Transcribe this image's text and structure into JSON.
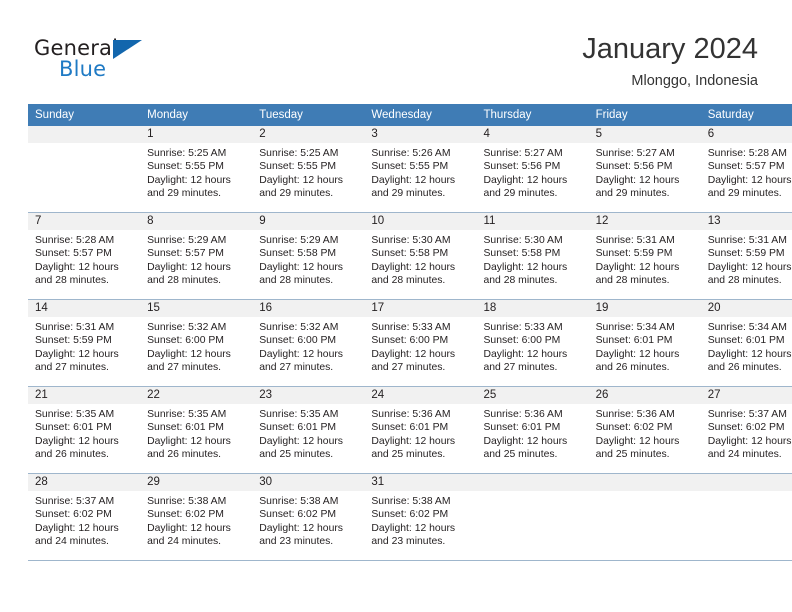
{
  "brand": {
    "name_part1": "General",
    "name_part2": "Blue",
    "triangle_icon": "triangle-icon",
    "color_primary": "#1266ad",
    "color_secondary": "#1f7ac4"
  },
  "header": {
    "title": "January 2024",
    "subtitle": "Mlonggo, Indonesia",
    "header_bg": "#3f7cb5",
    "band_bg": "#f1f1f1",
    "grid_line": "#9fb6cc"
  },
  "weekday_headers": [
    "Sunday",
    "Monday",
    "Tuesday",
    "Wednesday",
    "Thursday",
    "Friday",
    "Saturday"
  ],
  "weeks": [
    [
      {
        "day": "",
        "blank": true,
        "sunrise": "",
        "sunset": "",
        "daylight_1": "",
        "daylight_2": ""
      },
      {
        "day": "1",
        "sunrise": "Sunrise: 5:25 AM",
        "sunset": "Sunset: 5:55 PM",
        "daylight_1": "Daylight: 12 hours",
        "daylight_2": "and 29 minutes."
      },
      {
        "day": "2",
        "sunrise": "Sunrise: 5:25 AM",
        "sunset": "Sunset: 5:55 PM",
        "daylight_1": "Daylight: 12 hours",
        "daylight_2": "and 29 minutes."
      },
      {
        "day": "3",
        "sunrise": "Sunrise: 5:26 AM",
        "sunset": "Sunset: 5:55 PM",
        "daylight_1": "Daylight: 12 hours",
        "daylight_2": "and 29 minutes."
      },
      {
        "day": "4",
        "sunrise": "Sunrise: 5:27 AM",
        "sunset": "Sunset: 5:56 PM",
        "daylight_1": "Daylight: 12 hours",
        "daylight_2": "and 29 minutes."
      },
      {
        "day": "5",
        "sunrise": "Sunrise: 5:27 AM",
        "sunset": "Sunset: 5:56 PM",
        "daylight_1": "Daylight: 12 hours",
        "daylight_2": "and 29 minutes."
      },
      {
        "day": "6",
        "sunrise": "Sunrise: 5:28 AM",
        "sunset": "Sunset: 5:57 PM",
        "daylight_1": "Daylight: 12 hours",
        "daylight_2": "and 29 minutes."
      }
    ],
    [
      {
        "day": "7",
        "sunrise": "Sunrise: 5:28 AM",
        "sunset": "Sunset: 5:57 PM",
        "daylight_1": "Daylight: 12 hours",
        "daylight_2": "and 28 minutes."
      },
      {
        "day": "8",
        "sunrise": "Sunrise: 5:29 AM",
        "sunset": "Sunset: 5:57 PM",
        "daylight_1": "Daylight: 12 hours",
        "daylight_2": "and 28 minutes."
      },
      {
        "day": "9",
        "sunrise": "Sunrise: 5:29 AM",
        "sunset": "Sunset: 5:58 PM",
        "daylight_1": "Daylight: 12 hours",
        "daylight_2": "and 28 minutes."
      },
      {
        "day": "10",
        "sunrise": "Sunrise: 5:30 AM",
        "sunset": "Sunset: 5:58 PM",
        "daylight_1": "Daylight: 12 hours",
        "daylight_2": "and 28 minutes."
      },
      {
        "day": "11",
        "sunrise": "Sunrise: 5:30 AM",
        "sunset": "Sunset: 5:58 PM",
        "daylight_1": "Daylight: 12 hours",
        "daylight_2": "and 28 minutes."
      },
      {
        "day": "12",
        "sunrise": "Sunrise: 5:31 AM",
        "sunset": "Sunset: 5:59 PM",
        "daylight_1": "Daylight: 12 hours",
        "daylight_2": "and 28 minutes."
      },
      {
        "day": "13",
        "sunrise": "Sunrise: 5:31 AM",
        "sunset": "Sunset: 5:59 PM",
        "daylight_1": "Daylight: 12 hours",
        "daylight_2": "and 28 minutes."
      }
    ],
    [
      {
        "day": "14",
        "sunrise": "Sunrise: 5:31 AM",
        "sunset": "Sunset: 5:59 PM",
        "daylight_1": "Daylight: 12 hours",
        "daylight_2": "and 27 minutes."
      },
      {
        "day": "15",
        "sunrise": "Sunrise: 5:32 AM",
        "sunset": "Sunset: 6:00 PM",
        "daylight_1": "Daylight: 12 hours",
        "daylight_2": "and 27 minutes."
      },
      {
        "day": "16",
        "sunrise": "Sunrise: 5:32 AM",
        "sunset": "Sunset: 6:00 PM",
        "daylight_1": "Daylight: 12 hours",
        "daylight_2": "and 27 minutes."
      },
      {
        "day": "17",
        "sunrise": "Sunrise: 5:33 AM",
        "sunset": "Sunset: 6:00 PM",
        "daylight_1": "Daylight: 12 hours",
        "daylight_2": "and 27 minutes."
      },
      {
        "day": "18",
        "sunrise": "Sunrise: 5:33 AM",
        "sunset": "Sunset: 6:00 PM",
        "daylight_1": "Daylight: 12 hours",
        "daylight_2": "and 27 minutes."
      },
      {
        "day": "19",
        "sunrise": "Sunrise: 5:34 AM",
        "sunset": "Sunset: 6:01 PM",
        "daylight_1": "Daylight: 12 hours",
        "daylight_2": "and 26 minutes."
      },
      {
        "day": "20",
        "sunrise": "Sunrise: 5:34 AM",
        "sunset": "Sunset: 6:01 PM",
        "daylight_1": "Daylight: 12 hours",
        "daylight_2": "and 26 minutes."
      }
    ],
    [
      {
        "day": "21",
        "sunrise": "Sunrise: 5:35 AM",
        "sunset": "Sunset: 6:01 PM",
        "daylight_1": "Daylight: 12 hours",
        "daylight_2": "and 26 minutes."
      },
      {
        "day": "22",
        "sunrise": "Sunrise: 5:35 AM",
        "sunset": "Sunset: 6:01 PM",
        "daylight_1": "Daylight: 12 hours",
        "daylight_2": "and 26 minutes."
      },
      {
        "day": "23",
        "sunrise": "Sunrise: 5:35 AM",
        "sunset": "Sunset: 6:01 PM",
        "daylight_1": "Daylight: 12 hours",
        "daylight_2": "and 25 minutes."
      },
      {
        "day": "24",
        "sunrise": "Sunrise: 5:36 AM",
        "sunset": "Sunset: 6:01 PM",
        "daylight_1": "Daylight: 12 hours",
        "daylight_2": "and 25 minutes."
      },
      {
        "day": "25",
        "sunrise": "Sunrise: 5:36 AM",
        "sunset": "Sunset: 6:01 PM",
        "daylight_1": "Daylight: 12 hours",
        "daylight_2": "and 25 minutes."
      },
      {
        "day": "26",
        "sunrise": "Sunrise: 5:36 AM",
        "sunset": "Sunset: 6:02 PM",
        "daylight_1": "Daylight: 12 hours",
        "daylight_2": "and 25 minutes."
      },
      {
        "day": "27",
        "sunrise": "Sunrise: 5:37 AM",
        "sunset": "Sunset: 6:02 PM",
        "daylight_1": "Daylight: 12 hours",
        "daylight_2": "and 24 minutes."
      }
    ],
    [
      {
        "day": "28",
        "sunrise": "Sunrise: 5:37 AM",
        "sunset": "Sunset: 6:02 PM",
        "daylight_1": "Daylight: 12 hours",
        "daylight_2": "and 24 minutes."
      },
      {
        "day": "29",
        "sunrise": "Sunrise: 5:38 AM",
        "sunset": "Sunset: 6:02 PM",
        "daylight_1": "Daylight: 12 hours",
        "daylight_2": "and 24 minutes."
      },
      {
        "day": "30",
        "sunrise": "Sunrise: 5:38 AM",
        "sunset": "Sunset: 6:02 PM",
        "daylight_1": "Daylight: 12 hours",
        "daylight_2": "and 23 minutes."
      },
      {
        "day": "31",
        "sunrise": "Sunrise: 5:38 AM",
        "sunset": "Sunset: 6:02 PM",
        "daylight_1": "Daylight: 12 hours",
        "daylight_2": "and 23 minutes."
      },
      {
        "day": "",
        "blank": true,
        "sunrise": "",
        "sunset": "",
        "daylight_1": "",
        "daylight_2": ""
      },
      {
        "day": "",
        "blank": true,
        "sunrise": "",
        "sunset": "",
        "daylight_1": "",
        "daylight_2": ""
      },
      {
        "day": "",
        "blank": true,
        "sunrise": "",
        "sunset": "",
        "daylight_1": "",
        "daylight_2": ""
      }
    ]
  ]
}
